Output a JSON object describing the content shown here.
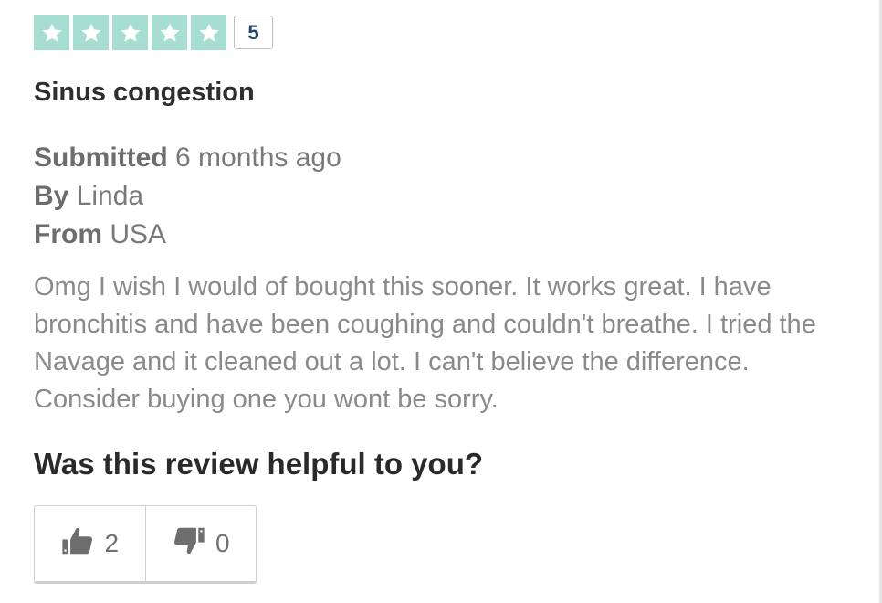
{
  "review": {
    "rating": {
      "stars_filled": 5,
      "stars_total": 5,
      "value": "5",
      "star_color": "#a6dfd2",
      "icon": "star-icon"
    },
    "title": "Sinus congestion",
    "meta": {
      "submitted_label": "Submitted",
      "submitted_value": "6 months ago",
      "by_label": "By",
      "by_value": "Linda",
      "from_label": "From",
      "from_value": "USA"
    },
    "body": "Omg I wish I would of bought this sooner. It works great. I have bronchitis and have been coughing and couldn't breathe. I tried the Navage and it cleaned out a lot. I can't believe the difference. Consider buying one you wont be sorry.",
    "helpful": {
      "question": "Was this review helpful to you?",
      "up": {
        "icon": "thumbs-up-icon",
        "count": "2"
      },
      "down": {
        "icon": "thumbs-down-icon",
        "count": "0"
      }
    }
  }
}
